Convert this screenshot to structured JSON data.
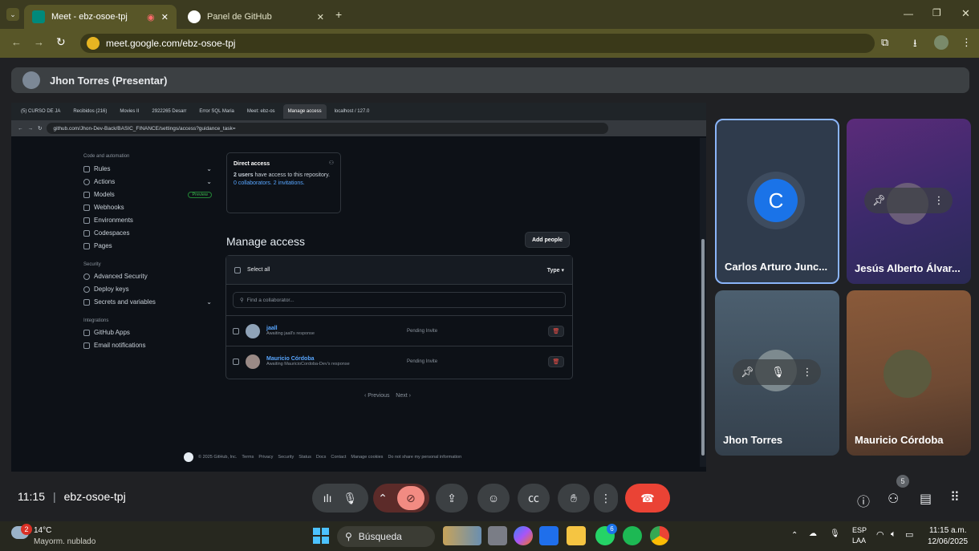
{
  "chrome": {
    "tabs": [
      {
        "label": "Meet - ebz-osoe-tpj"
      },
      {
        "label": "Panel de GitHub"
      }
    ],
    "url": "meet.google.com/ebz-osoe-tpj"
  },
  "meet": {
    "presenter": "Jhon Torres (Presentar)",
    "time": "11:15",
    "divider": "|",
    "code": "ebz-osoe-tpj",
    "participants": [
      {
        "name": "Carlos Arturo Junc...",
        "initial": "C"
      },
      {
        "name": "Jesús Alberto Álvar..."
      },
      {
        "name": "Jhon Torres"
      },
      {
        "name": "Mauricio Córdoba"
      }
    ],
    "people_count": "5"
  },
  "inner": {
    "tabs": [
      "(5) CURSO DE JA",
      "Recibidos (216)",
      "Movies II",
      "2922265 Desarr",
      "Error SQL Maria",
      "Meet: ebz-os",
      "Manage access",
      "localhost / 127.0"
    ],
    "url": "github.com/Jhon-Dev-Back/BASIC_FINANCE/settings/access?guidance_task=",
    "sidebar": {
      "code_heading": "Code and automation",
      "code_items": [
        "Rules",
        "Actions",
        "Models",
        "Webhooks",
        "Environments",
        "Codespaces",
        "Pages"
      ],
      "preview": "Preview",
      "security_heading": "Security",
      "security_items": [
        "Advanced Security",
        "Deploy keys",
        "Secrets and variables"
      ],
      "integrations_heading": "Integrations",
      "integration_items": [
        "GitHub Apps",
        "Email notifications"
      ]
    },
    "direct_access": {
      "title": "Direct access",
      "text1": "2 users",
      "text2": " have access to this repository. ",
      "link": "0 collaborators. 2 invitations."
    },
    "manage_title": "Manage access",
    "add_people": "Add people",
    "select_all": "Select all",
    "type": "Type ▾",
    "find_placeholder": "Find a collaborator...",
    "rows": [
      {
        "user": "jaall",
        "sub": "Awaiting jaall's response",
        "status": "Pending Invite"
      },
      {
        "user": "Mauricio Córdoba",
        "sub": "Awaiting MauricioCordoba-Dev's response",
        "status": "Pending Invite"
      }
    ],
    "previous": "‹ Previous",
    "next": "Next ›",
    "footer": [
      "© 2025 GitHub, Inc.",
      "Terms",
      "Privacy",
      "Security",
      "Status",
      "Docs",
      "Contact",
      "Manage cookies",
      "Do not share my personal information"
    ]
  },
  "taskbar": {
    "temp": "14°C",
    "weather": "Mayorm. nublado",
    "weather_badge": "2",
    "search": "Búsqueda",
    "lang1": "ESP",
    "lang2": "LAA",
    "time": "11:15 a.m.",
    "date": "12/06/2025",
    "whatsapp_badge": "6"
  },
  "colors": {
    "end_call": "#ea4335",
    "camera_off": "#f28b82",
    "accent": "#8ab4f8"
  }
}
